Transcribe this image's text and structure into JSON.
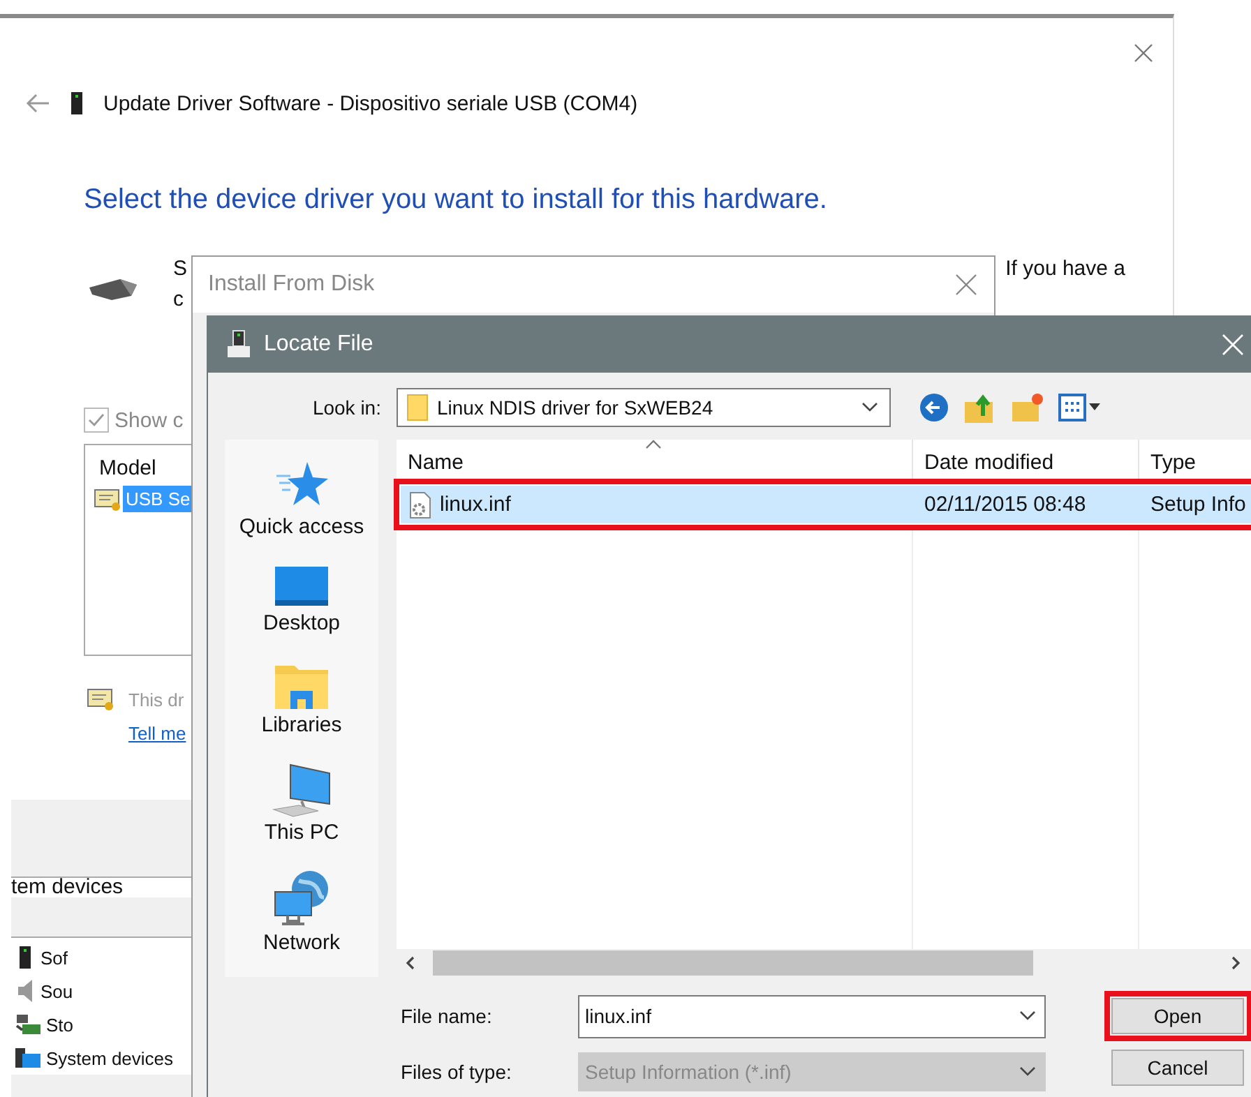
{
  "main_window": {
    "title": "Update Driver Software - Dispositivo seriale USB (COM4)",
    "heading": "Select the device driver you want to install for this hardware.",
    "intro_fragments": [
      "S",
      "c"
    ],
    "intro_right": "If you have a",
    "show_compatible": {
      "label": "Show c",
      "checked": true
    },
    "model_list": {
      "header": "Model",
      "items": [
        {
          "label": "USB Se",
          "selected": true
        }
      ]
    },
    "signed_note": "This dr",
    "link": "Tell me"
  },
  "device_manager": {
    "header_fragment": "tem devices",
    "tree_items": [
      {
        "label": "Sof",
        "kind": "software"
      },
      {
        "label": "Sou",
        "kind": "sound"
      },
      {
        "label": "Sto",
        "kind": "storage"
      },
      {
        "label": "System devices",
        "kind": "system"
      }
    ]
  },
  "install_dialog": {
    "title": "Install From Disk"
  },
  "locate_dialog": {
    "title": "Locate File",
    "look_in_label": "Look in:",
    "look_in_value": "Linux NDIS driver for SxWEB24",
    "places": [
      {
        "label": "Quick access",
        "kind": "quick_access"
      },
      {
        "label": "Desktop",
        "kind": "desktop"
      },
      {
        "label": "Libraries",
        "kind": "libraries"
      },
      {
        "label": "This PC",
        "kind": "pc"
      },
      {
        "label": "Network",
        "kind": "network"
      }
    ],
    "columns": [
      "Name",
      "Date modified",
      "Type"
    ],
    "files": [
      {
        "name": "linux.inf",
        "date": "02/11/2015 08:48",
        "type": "Setup Info",
        "selected": true,
        "highlighted": true
      }
    ],
    "file_name_label": "File name:",
    "file_name_value": "linux.inf",
    "file_type_label": "Files of type:",
    "file_type_value": "Setup Information (*.inf)",
    "file_type_disabled": true,
    "buttons": [
      {
        "label": "Open",
        "highlighted": true
      },
      {
        "label": "Cancel",
        "highlighted": false
      }
    ]
  }
}
